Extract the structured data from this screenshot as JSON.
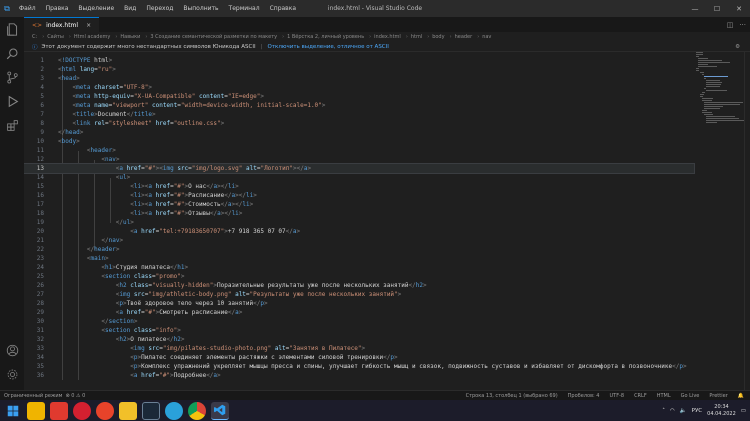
{
  "titlebar": {
    "menu": [
      "Файл",
      "Правка",
      "Выделение",
      "Вид",
      "Переход",
      "Выполнить",
      "Терминал",
      "Справка"
    ],
    "window_title": "index.html - Visual Studio Code",
    "controls": [
      "—",
      "☐",
      "✕"
    ]
  },
  "activitybar": {
    "top": [
      "files-icon",
      "search-icon",
      "source-control-icon",
      "run-debug-icon",
      "extensions-icon"
    ],
    "bottom": [
      "account-icon",
      "settings-gear-icon"
    ]
  },
  "tabs": [
    {
      "label": "index.html",
      "close": "×"
    }
  ],
  "breadcrumb": {
    "items": [
      "C:",
      "Сайты",
      "Html academy",
      "Навыки",
      "3 Создание семантической разметки по макету",
      "1 Вёрстка 2, личный уровень",
      "index.html",
      "html",
      "body",
      "header",
      "nav"
    ]
  },
  "notice": {
    "text": "Этот документ содержит много нестандартных символов Юникода ASCII",
    "link": "Отключить выделение, отличное от ASCII"
  },
  "editor": {
    "active_line": 13,
    "lines": [
      {
        "n": "1",
        "t": "<!DOCTYPE html>"
      },
      {
        "n": "2",
        "t": "<html lang=\"ru\">"
      },
      {
        "n": "3",
        "t": "<head>"
      },
      {
        "n": "4",
        "t": "    <meta charset=\"UTF-8\">"
      },
      {
        "n": "5",
        "t": "    <meta http-equiv=\"X-UA-Compatible\" content=\"IE=edge\">"
      },
      {
        "n": "6",
        "t": "    <meta name=\"viewport\" content=\"width=device-width, initial-scale=1.0\">"
      },
      {
        "n": "7",
        "t": "    <title>Document</title>"
      },
      {
        "n": "8",
        "t": "    <link rel=\"stylesheet\" href=\"outline.css\">"
      },
      {
        "n": "9",
        "t": "</head>"
      },
      {
        "n": "10",
        "t": "<body>"
      },
      {
        "n": "11",
        "t": "        <header>"
      },
      {
        "n": "12",
        "t": "            <nav>"
      },
      {
        "n": "13",
        "t": "                <a href=\"#\"><img src=\"img/logo.svg\" alt=\"Логотип\"></a>"
      },
      {
        "n": "14",
        "t": "                <ul>"
      },
      {
        "n": "15",
        "t": "                    <li><a href=\"#\">О нас</a></li>"
      },
      {
        "n": "16",
        "t": "                    <li><a href=\"#\">Расписание</a></li>"
      },
      {
        "n": "17",
        "t": "                    <li><a href=\"#\">Стоимость</a></li>"
      },
      {
        "n": "18",
        "t": "                    <li><a href=\"#\">Отзывы</a></li>"
      },
      {
        "n": "19",
        "t": "                </ul>"
      },
      {
        "n": "20",
        "t": "                    <a href=\"tel:+79183650707\">+7 918 365 07 07</a>"
      },
      {
        "n": "21",
        "t": "            </nav>"
      },
      {
        "n": "22",
        "t": "        </header>"
      },
      {
        "n": "23",
        "t": "        <main>"
      },
      {
        "n": "24",
        "t": "            <h1>Студия пилатеса</h1>"
      },
      {
        "n": "25",
        "t": "            <section class=\"promo\">"
      },
      {
        "n": "26",
        "t": "                <h2 class=\"visually-hidden\">Поразительные результаты уже после нескольких занятий</h2>"
      },
      {
        "n": "27",
        "t": "                <img src=\"img/athletic-body.png\" alt=\"Результаты уже после нескольких занятий\">"
      },
      {
        "n": "28",
        "t": "                <p>Твоё здоровое тело через 10 занятий</p>"
      },
      {
        "n": "29",
        "t": "                <a href=\"#\">Смотреть расписание</a>"
      },
      {
        "n": "30",
        "t": "            </section>"
      },
      {
        "n": "31",
        "t": "            <section class=\"info\">"
      },
      {
        "n": "32",
        "t": "                <h2>О пилатесе</h2>"
      },
      {
        "n": "33",
        "t": "                    <img src=\"img/pilates-studio-photo.png\" alt=\"Занятия в Пилатесе\">"
      },
      {
        "n": "34",
        "t": "                    <p>Пилатес соединяет элементы растяжки с элементами силовой тренировки</p>"
      },
      {
        "n": "35",
        "t": "                    <p>Комплекс упражнений укрепляет мышцы пресса и спины, улучшает гибкость мышц и связок, подвижность суставов и избавляет от дискомфорта в позвоночнике</p>"
      },
      {
        "n": "36",
        "t": "                    <a href=\"#\">Подробнее</a>"
      }
    ]
  },
  "statusbar": {
    "left": "⊗ 0 ⚠ 0",
    "restricted": "Ограниченный режим",
    "items": [
      "Строка 13, столбец 1 (выбрано 69)",
      "Пробелов: 4",
      "UTF-8",
      "CRLF",
      "HTML",
      "Go Live",
      "Prettier"
    ]
  },
  "taskbar": {
    "apps": [
      "start-icon",
      "file-explorer-icon",
      "onenote-icon",
      "opera-icon",
      "yandex-icon",
      "explorer-icon",
      "steam-icon",
      "telegram-icon",
      "chrome-icon",
      "vscode-icon"
    ],
    "lang": "РУС",
    "time": "20:34",
    "date": "04.04.2022"
  }
}
